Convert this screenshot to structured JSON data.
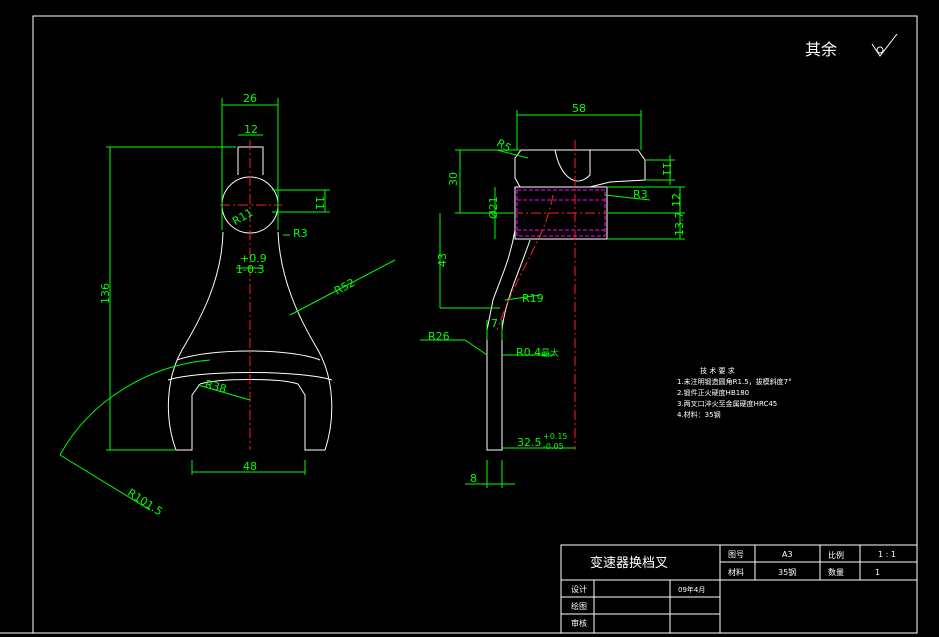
{
  "colors": {
    "background": "#000000",
    "frame": "#ffffff",
    "dimension": "#00ff00",
    "centerline": "#ff2020",
    "hidden": "#ff00ff",
    "outline": "#ffffff"
  },
  "roughness_note": "其余",
  "front_view": {
    "dim_26": "26",
    "dim_12": "12",
    "dim_11": "11",
    "dim_r11": "R11",
    "dim_r3": "R3",
    "tol_upper": "+0.9",
    "tol_lower": "1-0.3",
    "dim_r52": "R52",
    "dim_136": "136",
    "dim_r38": "R38",
    "dim_48": "48",
    "dim_r101_5": "R101.5"
  },
  "side_view": {
    "dim_58": "58",
    "dim_r5": "R5",
    "dim_30": "30",
    "dim_11": "11",
    "dim_r3": "R3",
    "dim_12": "12",
    "dim_21": "Ø21",
    "dim_13_7": "13.7",
    "dim_43": "43",
    "dim_r19": "R19",
    "dim_7": "7",
    "dim_r26": "R26",
    "dim_r04": "R0.4",
    "dim_r04_note": "最大",
    "dim_32_5": "32.5",
    "dim_32_5_tol_upper": "+0.15",
    "dim_32_5_tol_lower": "-0.05",
    "dim_8": "8"
  },
  "tech_requirements": {
    "heading": "技 术 要 求",
    "items": [
      "1.未注明锻造圆角R1.5，拔模斜度7°",
      "2.锻件正火硬度HB180",
      "3.两叉口淬火至金属硬度HRC45",
      "4.材料：35钢"
    ]
  },
  "title_block": {
    "part_name": "变速器换档叉",
    "label_drawing_no": "图号",
    "value_drawing_no": "A3",
    "label_scale": "比例",
    "value_scale": "1 : 1",
    "label_material": "材料",
    "value_material": "35钢",
    "label_quantity": "数量",
    "value_quantity": "1",
    "label_design": "设计",
    "value_date": "09年4月",
    "label_drafting": "绘图",
    "label_review": "审核"
  }
}
